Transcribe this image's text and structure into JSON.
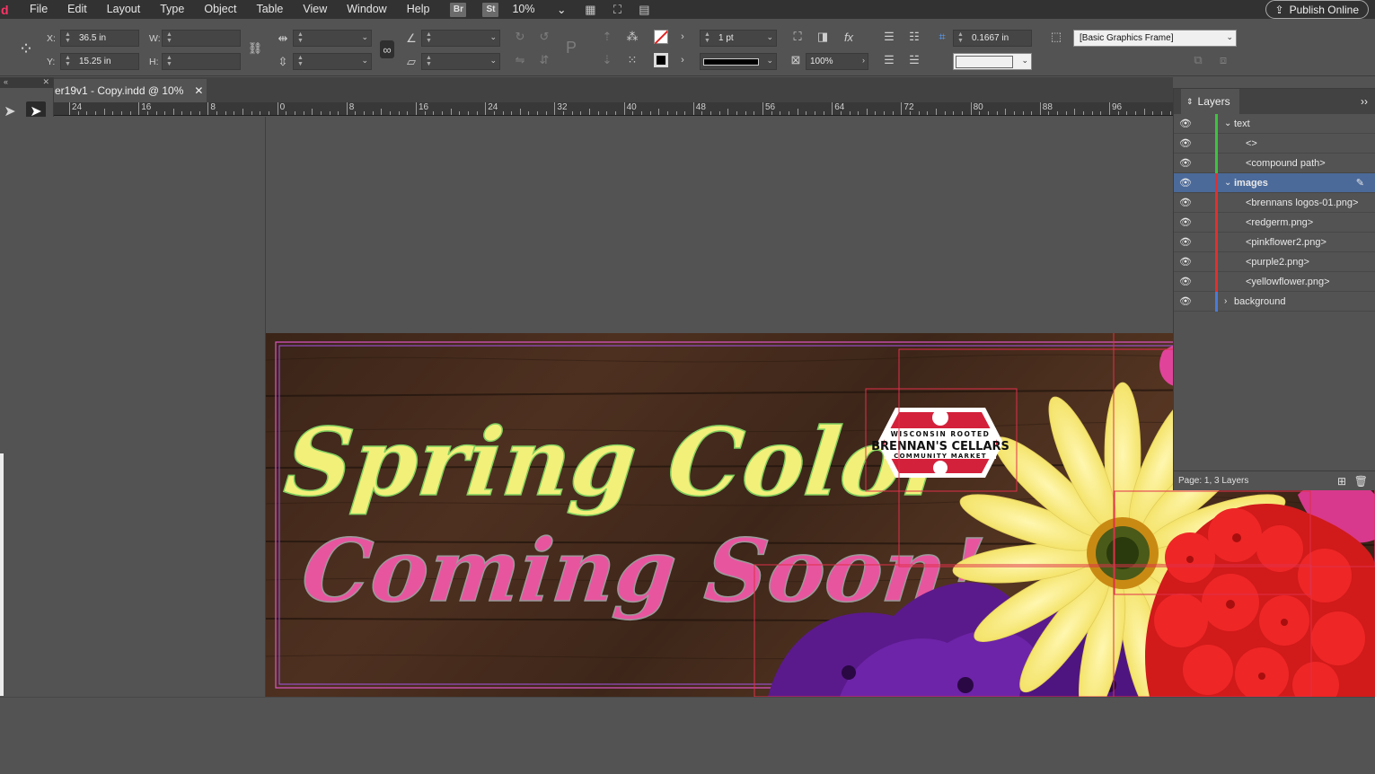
{
  "menubar": {
    "items": [
      "File",
      "Edit",
      "Layout",
      "Type",
      "Object",
      "Table",
      "View",
      "Window",
      "Help"
    ],
    "bridge": "Br",
    "stock": "St",
    "zoom": "10%",
    "publish_label": "Publish Online"
  },
  "control": {
    "x_label": "X:",
    "x_value": "36.5 in",
    "y_label": "Y:",
    "y_value": "15.25 in",
    "w_label": "W:",
    "h_label": "H:",
    "stroke_weight": "1 pt",
    "opacity": "100%",
    "offset": "0.1667 in",
    "object_style": "[Basic Graphics Frame]"
  },
  "document": {
    "tab_title": "er19v1 - Copy.indd @ 10%",
    "ruler_labels": [
      "24",
      "16",
      "8",
      "0",
      "8",
      "16",
      "24",
      "32",
      "40",
      "48",
      "56",
      "64",
      "72",
      "80",
      "88",
      "96"
    ]
  },
  "artwork": {
    "line1": "Spring Color",
    "line2": "Coming Soon!",
    "logo_top": "WISCONSIN ROOTED",
    "logo_main": "BRENNAN'S CELLARS",
    "logo_bottom": "COMMUNITY MARKET"
  },
  "layers": {
    "title": "Layers",
    "rows": [
      {
        "name": "text",
        "indent": 0,
        "expanded": true,
        "color": "#3ec33e",
        "selected": false
      },
      {
        "name": "<>",
        "indent": 1,
        "color": "#3ec33e",
        "selected": false
      },
      {
        "name": "<compound path>",
        "indent": 1,
        "color": "#3ec33e",
        "selected": false
      },
      {
        "name": "images",
        "indent": 0,
        "expanded": true,
        "color": "#e03030",
        "selected": true
      },
      {
        "name": "<brennans logos-01.png>",
        "indent": 1,
        "color": "#e03030",
        "selected": false
      },
      {
        "name": "<redgerm.png>",
        "indent": 1,
        "color": "#e03030",
        "selected": false
      },
      {
        "name": "<pinkflower2.png>",
        "indent": 1,
        "color": "#e03030",
        "selected": false
      },
      {
        "name": "<purple2.png>",
        "indent": 1,
        "color": "#e03030",
        "selected": false
      },
      {
        "name": "<yellowflower.png>",
        "indent": 1,
        "color": "#e03030",
        "selected": false
      },
      {
        "name": "background",
        "indent": 0,
        "expanded": false,
        "color": "#4a7bd8",
        "selected": false
      }
    ],
    "footer": "Page: 1, 3 Layers"
  },
  "colors": {
    "accent_pink": "#e8559f",
    "accent_yellow": "#f3f07a",
    "logo_red": "#d4213b",
    "selection_blue": "#4b6a9a"
  }
}
